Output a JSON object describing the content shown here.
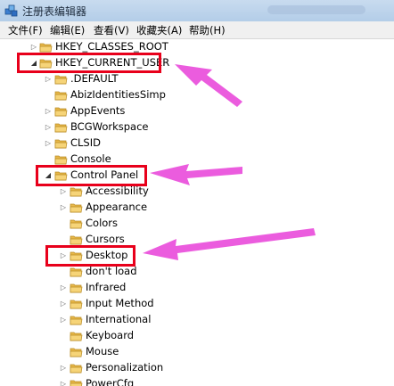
{
  "window": {
    "title": "注册表编辑器"
  },
  "menu": {
    "items": [
      {
        "label": "文件(F)"
      },
      {
        "label": "编辑(E)"
      },
      {
        "label": "查看(V)"
      },
      {
        "label": "收藏夹(A)"
      },
      {
        "label": "帮助(H)"
      }
    ]
  },
  "tree": {
    "rows": [
      {
        "label": "HKEY_CLASSES_ROOT",
        "level": 0,
        "expander": "collapsed"
      },
      {
        "label": "HKEY_CURRENT_USER",
        "level": 0,
        "expander": "expanded"
      },
      {
        "label": ".DEFAULT",
        "level": 1,
        "expander": "collapsed"
      },
      {
        "label": "AbizIdentitiesSimp",
        "level": 1,
        "expander": "none"
      },
      {
        "label": "AppEvents",
        "level": 1,
        "expander": "collapsed"
      },
      {
        "label": "BCGWorkspace",
        "level": 1,
        "expander": "collapsed"
      },
      {
        "label": "CLSID",
        "level": 1,
        "expander": "collapsed"
      },
      {
        "label": "Console",
        "level": 1,
        "expander": "none"
      },
      {
        "label": "Control Panel",
        "level": 1,
        "expander": "expanded"
      },
      {
        "label": "Accessibility",
        "level": 2,
        "expander": "collapsed"
      },
      {
        "label": "Appearance",
        "level": 2,
        "expander": "collapsed"
      },
      {
        "label": "Colors",
        "level": 2,
        "expander": "none"
      },
      {
        "label": "Cursors",
        "level": 2,
        "expander": "none"
      },
      {
        "label": "Desktop",
        "level": 2,
        "expander": "collapsed"
      },
      {
        "label": "don't load",
        "level": 2,
        "expander": "none"
      },
      {
        "label": "Infrared",
        "level": 2,
        "expander": "collapsed"
      },
      {
        "label": "Input Method",
        "level": 2,
        "expander": "collapsed"
      },
      {
        "label": "International",
        "level": 2,
        "expander": "collapsed"
      },
      {
        "label": "Keyboard",
        "level": 2,
        "expander": "none"
      },
      {
        "label": "Mouse",
        "level": 2,
        "expander": "none"
      },
      {
        "label": "Personalization",
        "level": 2,
        "expander": "collapsed"
      },
      {
        "label": "PowerCfg",
        "level": 2,
        "expander": "collapsed"
      }
    ]
  },
  "colors": {
    "highlight_box": "#e8001b",
    "arrow": "#e83fd8",
    "folder": "#e8b84a"
  },
  "icons": {
    "app": "registry-editor-icon",
    "folder": "folder-icon",
    "expanded": "triangle-expanded-icon",
    "collapsed": "triangle-collapsed-icon"
  }
}
